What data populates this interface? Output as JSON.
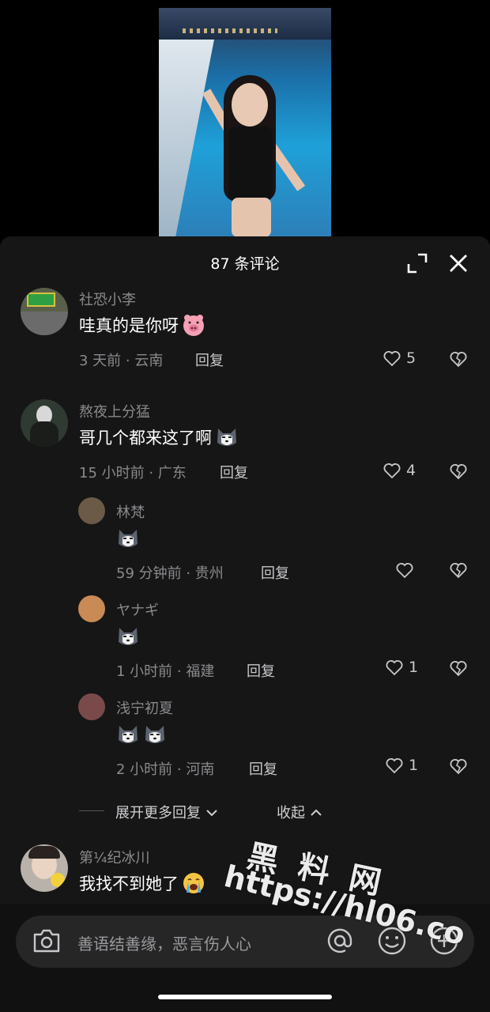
{
  "header": {
    "title": "87 条评论"
  },
  "comments": [
    {
      "name": "社恐小李",
      "text": "哇真的是你呀",
      "emoji": "pig-face-emoji",
      "meta": "3 天前 · 云南",
      "reply": "回复",
      "likes": "5"
    },
    {
      "name": "熬夜上分猛",
      "text": "哥几个都来这了啊",
      "emoji": "husky-emoji",
      "meta": "15 小时前 · 广东",
      "reply": "回复",
      "likes": "4",
      "replies": [
        {
          "name": "林梵",
          "emoji_count": 1,
          "meta": "59 分钟前 · 贵州",
          "reply": "回复",
          "likes": ""
        },
        {
          "name": "ヤナギ",
          "emoji_count": 1,
          "meta": "1 小时前 · 福建",
          "reply": "回复",
          "likes": "1"
        },
        {
          "name": "浅宁初夏",
          "emoji_count": 2,
          "meta": "2 小时前 · 河南",
          "reply": "回复",
          "likes": "1"
        }
      ]
    },
    {
      "name": "第¼纪冰川",
      "text": "我找不到她了",
      "emoji": "crying-face-emoji"
    }
  ],
  "thread": {
    "expand_label": "展开更多回复",
    "collapse_label": "收起"
  },
  "input": {
    "placeholder": "善语结善缘，恶言伤人心"
  },
  "watermark": {
    "cn": "黑料网",
    "url": "https://hl06.co"
  },
  "colors": {
    "sheet": "#161616",
    "meta": "#8a8a8e",
    "accent": "#ffffff"
  }
}
